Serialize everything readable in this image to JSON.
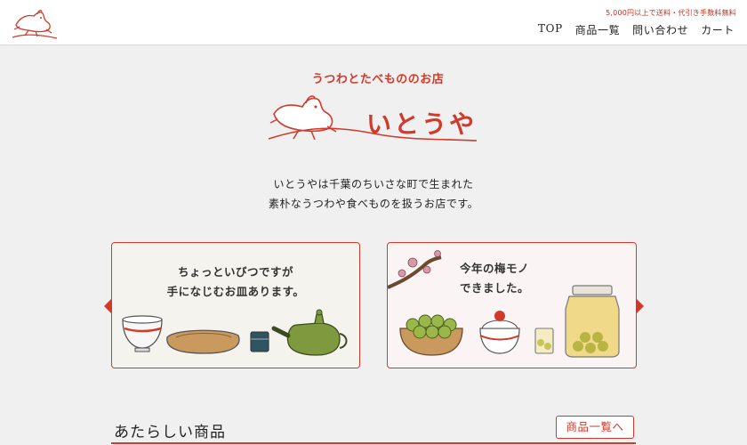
{
  "header": {
    "shipping_note": "5,000円以上で送料・代引き手数料無料",
    "nav": [
      {
        "label": "TOP"
      },
      {
        "label": "商品一覧"
      },
      {
        "label": "問い合わせ"
      },
      {
        "label": "カート"
      }
    ]
  },
  "brand": {
    "tagline": "うつわとたべもののお店",
    "name": "いとうや"
  },
  "intro": {
    "line1": "いとうやは千葉のちいさな町で生まれた",
    "line2": "素朴なうつわや食べものを扱うお店です。"
  },
  "banners": [
    {
      "line1": "ちょっといびつですが",
      "line2": "手になじむお皿あります。"
    },
    {
      "line1": "今年の梅モノ",
      "line2": "できました。"
    }
  ],
  "new_items": {
    "title": "あたらしい商品",
    "more_label": "商品一覧へ"
  },
  "colors": {
    "accent": "#d1392a",
    "background": "#f1f0f0",
    "header_bg": "#ffffff"
  },
  "icons": [
    "dog-logo-icon",
    "carousel-prev-icon",
    "carousel-next-icon"
  ]
}
